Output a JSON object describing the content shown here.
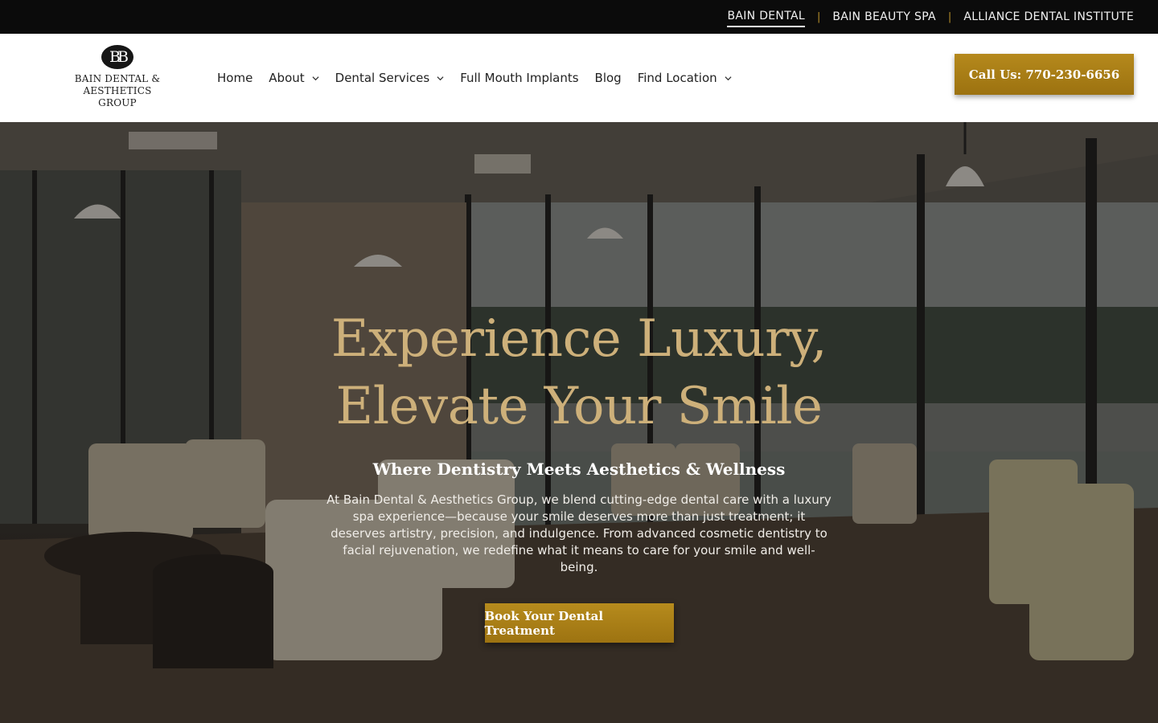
{
  "topbar": {
    "links": [
      {
        "label": "BAIN DENTAL"
      },
      {
        "label": "BAIN BEAUTY SPA"
      },
      {
        "label": "ALLIANCE DENTAL INSTITUTE"
      }
    ],
    "separator": "|"
  },
  "logo": {
    "monogram": "BB",
    "line1": "BAIN DENTAL &",
    "line2": "AESTHETICS GROUP"
  },
  "nav": {
    "items": [
      {
        "label": "Home"
      },
      {
        "label": "About"
      },
      {
        "label": "Dental Services"
      },
      {
        "label": "Full Mouth Implants"
      },
      {
        "label": "Blog"
      },
      {
        "label": "Find Location"
      }
    ]
  },
  "header": {
    "call_label": "Call Us: 770-230-6656"
  },
  "hero": {
    "title_line1": "Experience Luxury,",
    "title_line2": "Elevate Your Smile",
    "subtitle": "Where Dentistry Meets Aesthetics & Wellness",
    "body": "At Bain Dental & Aesthetics Group, we blend cutting-edge dental care with a luxury spa experience—because your smile deserves more than just treatment; it deserves artistry, precision, and indulgence. From advanced cosmetic dentistry to facial rejuvenation, we redefine what it means to care for your smile and well-being.",
    "cta_label": "Book Your Dental Treatment"
  },
  "colors": {
    "accent_gold": "#a87b12",
    "title_gold": "#cdb07a",
    "topbar_bg": "#0b0b0b"
  }
}
